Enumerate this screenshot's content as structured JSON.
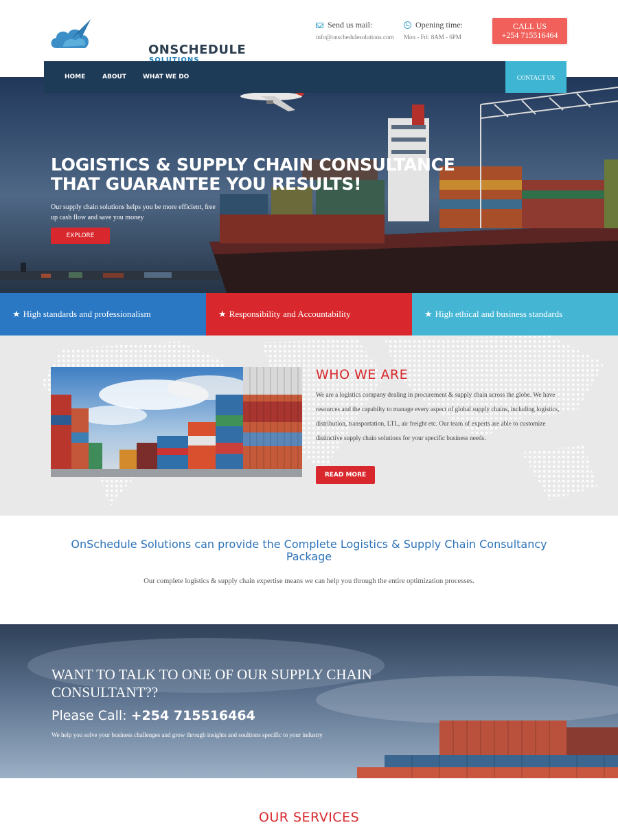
{
  "brand": {
    "name": "ONSCHEDULE",
    "tagline": "SOLUTIONS"
  },
  "header": {
    "mail_label": "Send us mail:",
    "mail_value": "info@onschedulesolutions.com",
    "hours_label": "Opening time:",
    "hours_value": "Mon - Fri: 8AM - 6PM",
    "call_label": "CALL US",
    "call_number": "+254 715516464"
  },
  "nav": {
    "items": [
      "HOME",
      "ABOUT",
      "WHAT WE DO"
    ],
    "contact": "CONTACT US"
  },
  "hero": {
    "title_line1": "LOGISTICS & SUPPLY CHAIN CONSULTANCE",
    "title_line2": "THAT GUARANTEE YOU RESULTS!",
    "subtitle": "Our supply chain solutions helps you be more efficient, free up cash flow and save you money",
    "button": "EXPLORE"
  },
  "features": [
    {
      "label": "High standards and professionalism",
      "color": "#2a78c4"
    },
    {
      "label": "Responsibility and Accountability",
      "color": "#d9282d"
    },
    {
      "label": "High ethical and business standards",
      "color": "#44b6d4"
    }
  ],
  "who": {
    "title": "WHO WE ARE",
    "text": "We are a logistics company dealing in procurement & supply chain across the globe. We have resources and the capabilty to manage every aspect of global supply chains, including logistics, distribution, transportation, LTL, air freight etc. Our team of experts are able to customize distinctive supply chain solutions for your specific business needs.",
    "button": "READ MORE"
  },
  "package": {
    "title": "OnSchedule Solutions can provide the Complete Logistics & Supply Chain Consultancy Package",
    "subtitle": "Our complete logistics & supply chain expertise means we can help you through the entire optimization processes."
  },
  "cta": {
    "title": "WANT TO TALK TO ONE OF OUR SUPPLY CHAIN CONSULTANT??",
    "call_prefix": "Please Call:",
    "call_number": "+254 715516464",
    "subtitle": "We help you solve your business challenges and grow through insights and soultions specific to your industry"
  },
  "services": {
    "title": "OUR SERVICES"
  },
  "colors": {
    "accent_red": "#d9282d",
    "accent_blue": "#2a78c4",
    "accent_cyan": "#44b6d4",
    "nav_bg": "#1d3a57",
    "call_btn": "#f1605a"
  }
}
